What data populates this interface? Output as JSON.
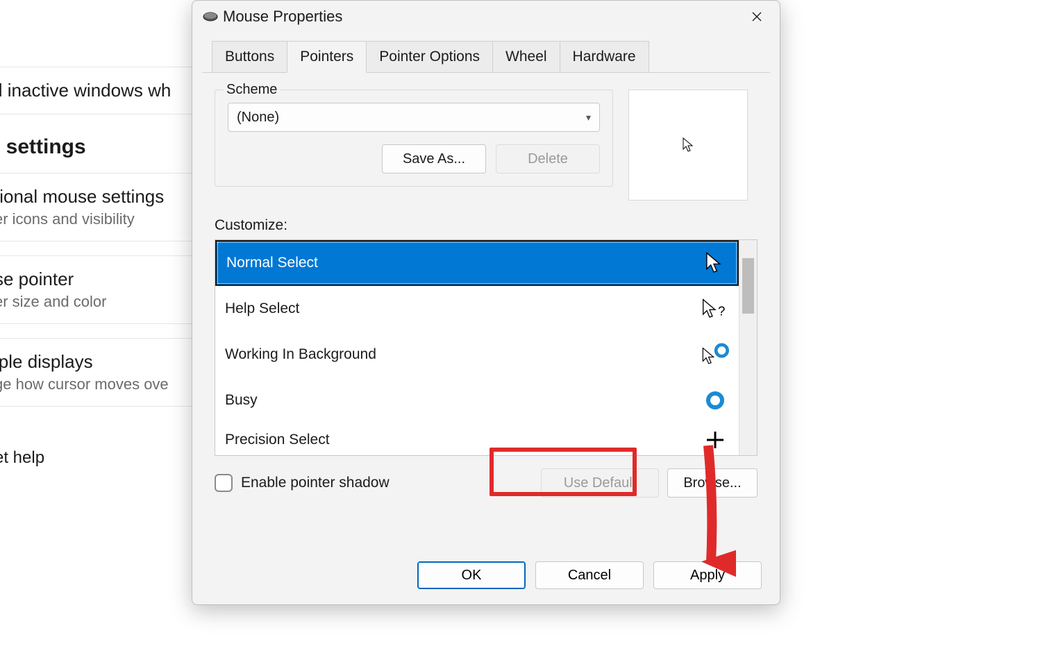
{
  "background": {
    "row1_title": "ll inactive windows wh",
    "heading": "l settings",
    "row2_title": "tional mouse settings",
    "row2_sub": "er icons and visibility",
    "row3_title": "se pointer",
    "row3_sub": "er size and color",
    "row4_title": "iple displays",
    "row4_sub": "ge how cursor moves ove",
    "help": "et help"
  },
  "dialog": {
    "title": "Mouse Properties",
    "tabs": [
      "Buttons",
      "Pointers",
      "Pointer Options",
      "Wheel",
      "Hardware"
    ],
    "active_tab": "Pointers",
    "scheme_group_label": "Scheme",
    "scheme_value": "(None)",
    "save_as": "Save As...",
    "delete": "Delete",
    "customize_label": "Customize:",
    "cursors": [
      {
        "label": "Normal Select",
        "icon": "arrow",
        "selected": true
      },
      {
        "label": "Help Select",
        "icon": "arrow-help",
        "selected": false
      },
      {
        "label": "Working In Background",
        "icon": "arrow-ring",
        "selected": false
      },
      {
        "label": "Busy",
        "icon": "ring",
        "selected": false
      },
      {
        "label": "Precision Select",
        "icon": "cross",
        "selected": false
      }
    ],
    "enable_shadow_label": "Enable pointer shadow",
    "use_default": "Use Default",
    "browse": "Browse...",
    "ok": "OK",
    "cancel": "Cancel",
    "apply": "Apply"
  },
  "annotation": {
    "highlight_target": "use-default-button",
    "arrow_target": "apply-button"
  }
}
